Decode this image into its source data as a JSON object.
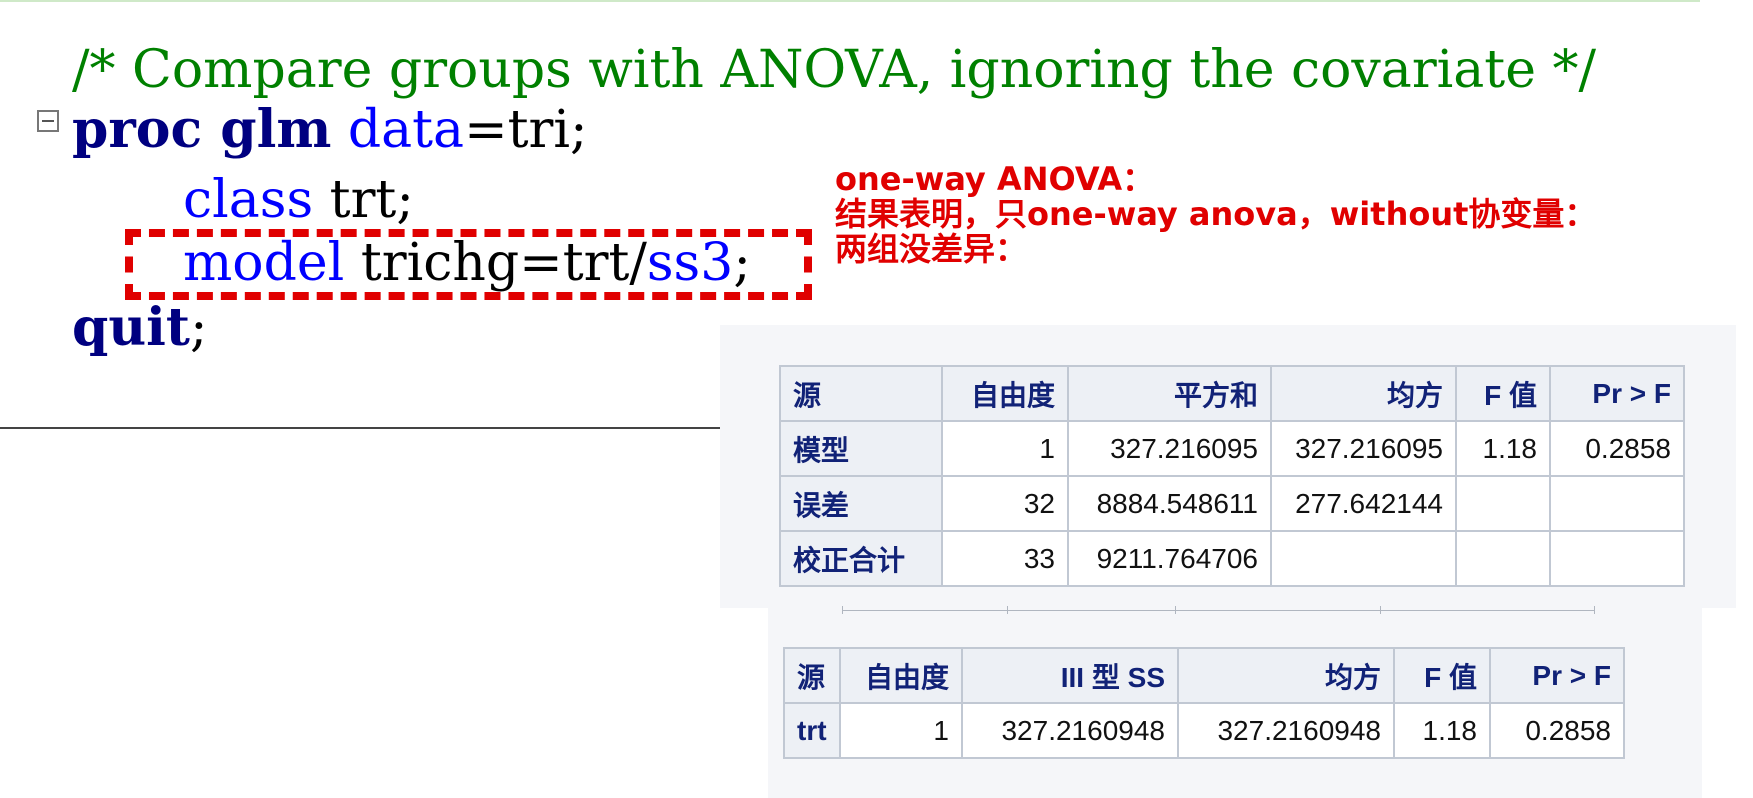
{
  "code": {
    "comment": "/* Compare groups with ANOVA, ignoring the covariate */",
    "line2": {
      "kw1": "proc glm",
      "opt": " data",
      "rest": "=tri;"
    },
    "line3": {
      "opt": "class",
      "rest": " trt;"
    },
    "line4": {
      "opt": "model",
      "rest": " trichg=trt/",
      "opt2": "ss3",
      "end": ";"
    },
    "line5": {
      "kw": "quit",
      "rest": ";"
    }
  },
  "annotation": {
    "line1": "one-way ANOVA：",
    "line2": "结果表明，只one-way anova，without协变量：",
    "line3": "两组没差异："
  },
  "anova_table": {
    "headers": [
      "源",
      "自由度",
      "平方和",
      "均方",
      "F 值",
      "Pr > F"
    ],
    "rows": [
      [
        "模型",
        "1",
        "327.216095",
        "327.216095",
        "1.18",
        "0.2858"
      ],
      [
        "误差",
        "32",
        "8884.548611",
        "277.642144",
        "",
        ""
      ],
      [
        "校正合计",
        "33",
        "9211.764706",
        "",
        "",
        ""
      ]
    ]
  },
  "type3_table": {
    "headers": [
      "源",
      "自由度",
      "III 型 SS",
      "均方",
      "F 值",
      "Pr > F"
    ],
    "rows": [
      [
        "trt",
        "1",
        "327.2160948",
        "327.2160948",
        "1.18",
        "0.2858"
      ]
    ]
  }
}
